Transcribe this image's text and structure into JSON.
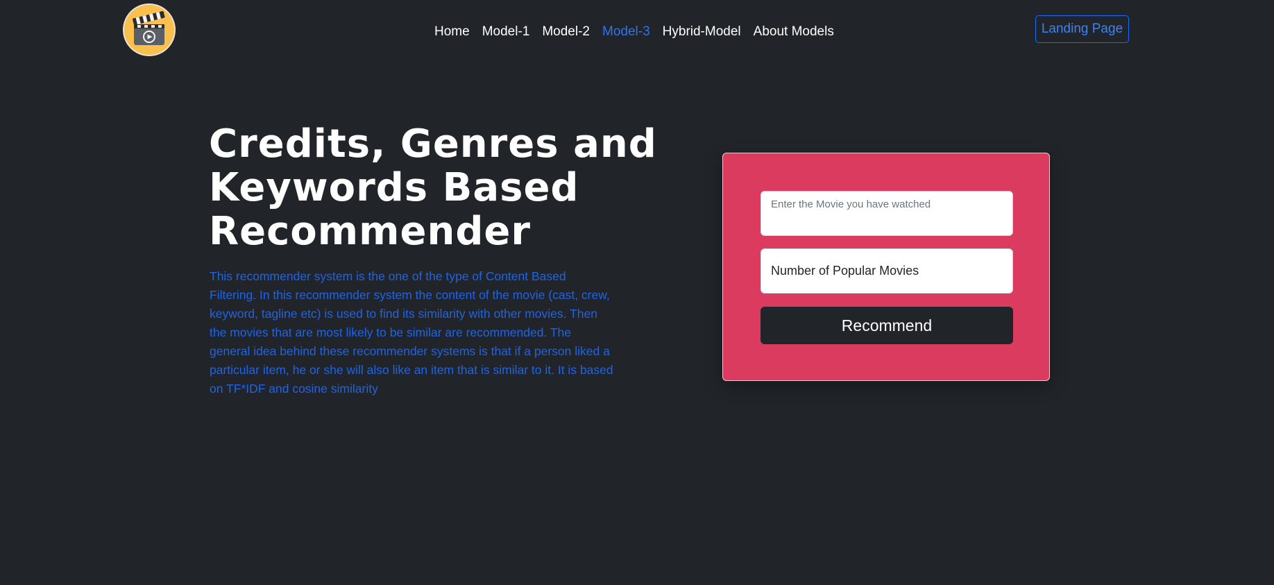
{
  "navbar": {
    "logo_name": "movie-clapperboard-logo",
    "links": [
      {
        "label": "Home",
        "active": false
      },
      {
        "label": "Model-1",
        "active": false
      },
      {
        "label": "Model-2",
        "active": false
      },
      {
        "label": "Model-3",
        "active": true
      },
      {
        "label": "Hybrid-Model",
        "active": false
      },
      {
        "label": "About Models",
        "active": false
      }
    ],
    "landing_button_label": "Landing Page"
  },
  "hero": {
    "title": "Credits, Genres and Keywords Based Recommender",
    "description": "This recommender system is the one of the type of Content Based Filtering. In this recommender system the content of the movie (cast, crew, keyword, tagline etc) is used to find its similarity with other movies. Then the movies that are most likely to be similar are recommended. The general idea behind these recommender systems is that if a person liked a particular item, he or she will also like an item that is similar to it. It is based on TF*IDF and cosine similarity"
  },
  "form": {
    "movie_placeholder": "Enter the Movie you have watched",
    "movie_value": "",
    "count_placeholder": "Number of Popular Movies",
    "count_value": "",
    "submit_label": "Recommend"
  },
  "colors": {
    "background": "#212529",
    "accent_blue": "#0d6efd",
    "card_red": "#dc3b60",
    "button_dark": "#212529"
  }
}
